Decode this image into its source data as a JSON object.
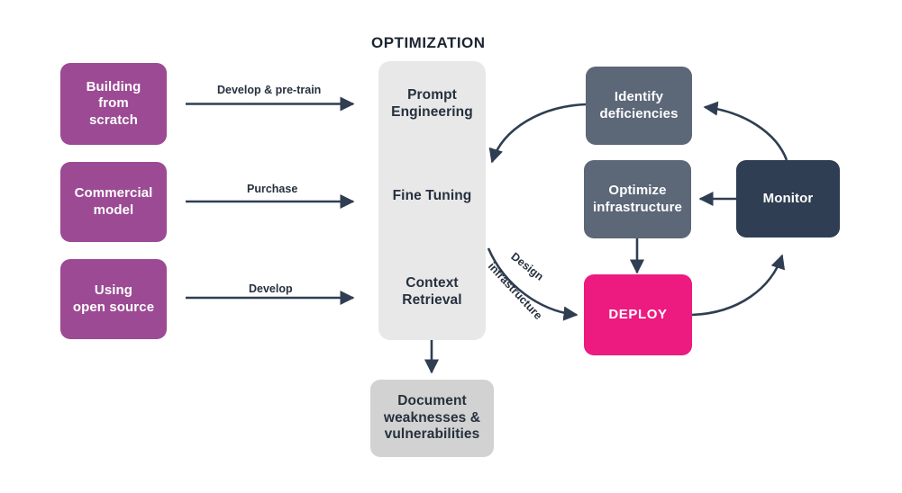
{
  "diagram": {
    "title": "OPTIMIZATION",
    "colors": {
      "source_box": "#9c4a94",
      "panel": "#e8e8e8",
      "slate_box": "#5c6778",
      "navy_box": "#2f3e52",
      "deploy_box": "#ed1a80",
      "document_box": "#d2d2d2",
      "arrow": "#2f3e52",
      "text_dark": "#26303e",
      "text_light": "#ffffff",
      "background": "#ffffff"
    }
  },
  "sources": [
    {
      "id": "building-from-scratch",
      "label": "Building\nfrom\nscratch"
    },
    {
      "id": "commercial-model",
      "label": "Commercial\nmodel"
    },
    {
      "id": "using-open-source",
      "label": "Using\nopen source"
    }
  ],
  "source_edge_labels": [
    {
      "id": "develop-and-pre-train",
      "label": "Develop & pre-train"
    },
    {
      "id": "purchase",
      "label": "Purchase"
    },
    {
      "id": "develop",
      "label": "Develop"
    }
  ],
  "optimization_panel": {
    "title": "OPTIMIZATION",
    "stages": [
      {
        "id": "prompt-engineering",
        "label": "Prompt\nEngineering"
      },
      {
        "id": "fine-tuning",
        "label": "Fine Tuning"
      },
      {
        "id": "context-retrieval",
        "label": "Context\nRetrieval"
      }
    ]
  },
  "cycle_nodes": [
    {
      "id": "identify-deficiencies",
      "label": "Identify\ndeficiencies"
    },
    {
      "id": "optimize-infrastructure",
      "label": "Optimize\ninfrastructure"
    },
    {
      "id": "monitor",
      "label": "Monitor"
    },
    {
      "id": "deploy",
      "label": "DEPLOY"
    }
  ],
  "document_node": {
    "id": "document-weaknesses",
    "label": "Document\nweaknesses &\nvulnerabilities"
  },
  "curve_labels": [
    {
      "id": "design",
      "label": "Design"
    },
    {
      "id": "infrastructure",
      "label": "infrastructure"
    }
  ]
}
